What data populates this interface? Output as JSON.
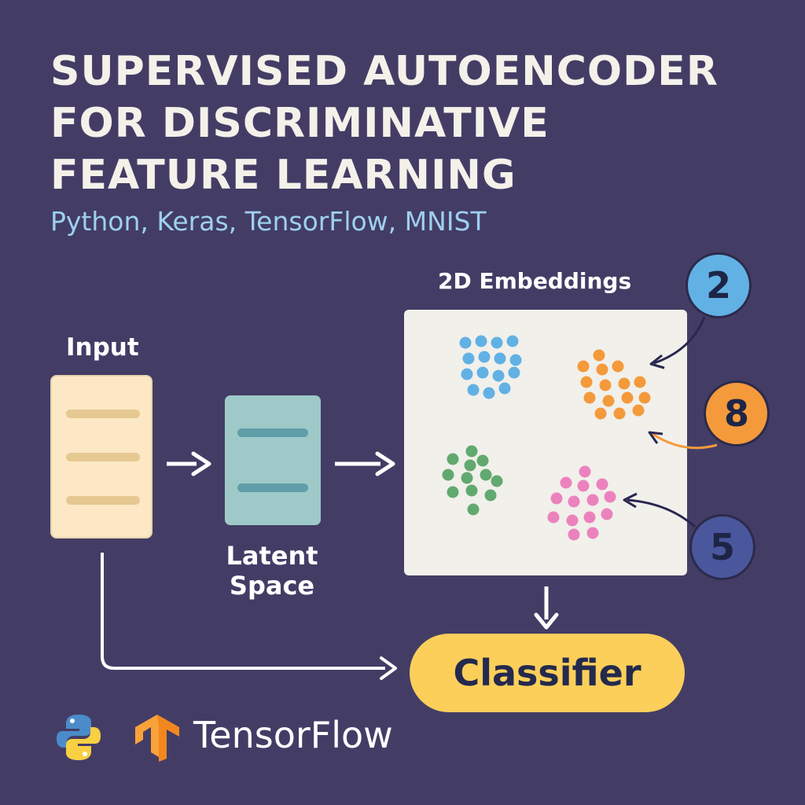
{
  "title": {
    "lines": [
      "SUPERVISED AUTOENCODER",
      "FOR DISCRIMINATIVE",
      "FEATURE LEARNING"
    ]
  },
  "subtitle": "Python, Keras, TensorFlow, MNIST",
  "diagram": {
    "input_label": "Input",
    "latent_label": "Latent Space",
    "embeddings_label": "2D Embeddings",
    "classifier_label": "Classifier"
  },
  "clusters": [
    {
      "label": "2",
      "color": "#62b1e5"
    },
    {
      "label": "8",
      "color": "#f49a3b"
    },
    {
      "label": "5",
      "color": "#ec82bd"
    },
    {
      "label": "",
      "color": "#62a96f"
    }
  ],
  "footer": {
    "tensorflow_text": "TensorFlow",
    "icons": [
      "python-logo-icon",
      "tensorflow-logo-icon"
    ]
  },
  "colors": {
    "background": "#433d66",
    "subtitle": "#9fd0ef",
    "classifier": "#fbcf5a"
  }
}
